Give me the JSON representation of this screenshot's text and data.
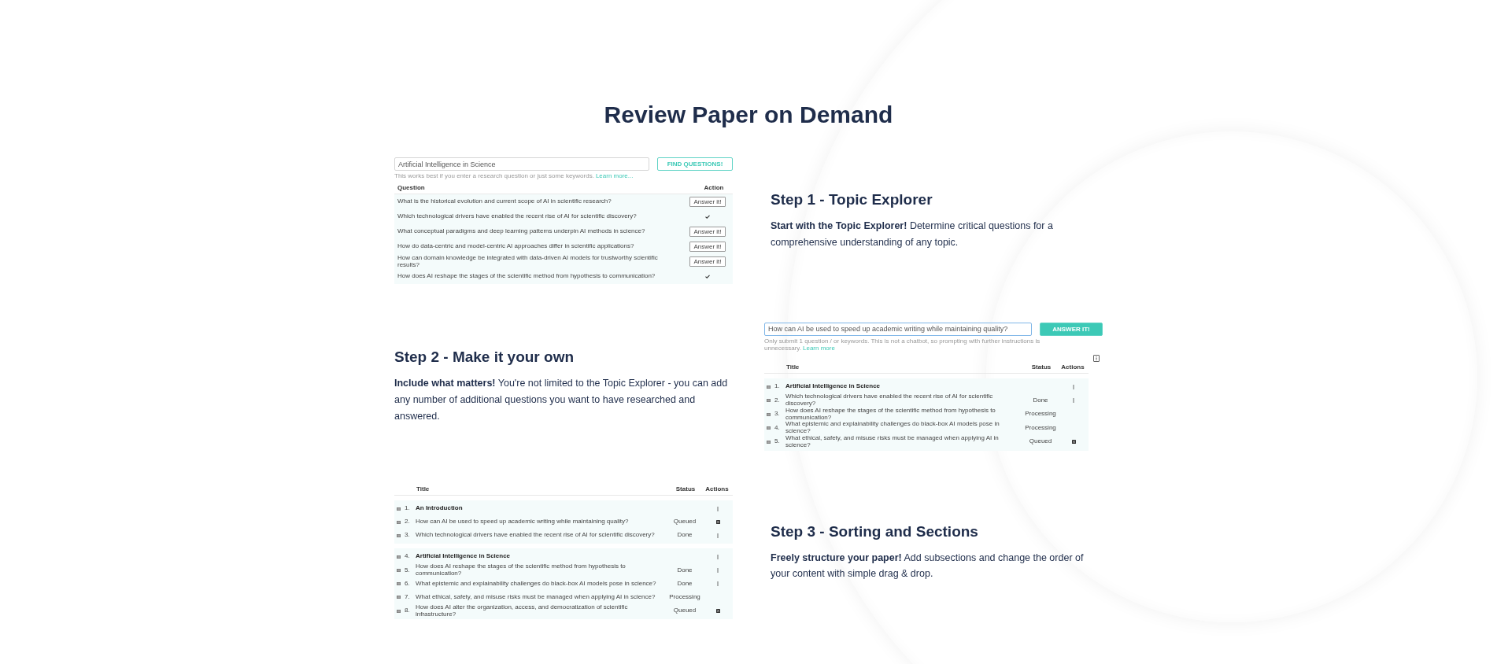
{
  "title": "Review Paper on Demand",
  "steps": [
    {
      "heading": "Step 1 - Topic Explorer",
      "text": "**Start with the Topic Explorer!** Determine critical questions for a comprehensive understanding of any topic."
    },
    {
      "heading": "Step 2 - Make it your own",
      "text": "**Include what matters!** You're not limited to the Topic Explorer - you can add any number of additional questions you want to have researched and answered."
    },
    {
      "heading": "Step 3 - Sorting and Sections",
      "text": "**Freely structure your paper!** Add subsections and change the order of your content with simple drag & drop."
    }
  ],
  "explorer": {
    "query": "Artificial Intelligence in Science",
    "button": "FIND QUESTIONS!",
    "hint": "This works best if you enter a research question or just some keywords.",
    "hint_link": "Learn more...",
    "columns": [
      "Question",
      "Action"
    ],
    "rows": [
      {
        "question": "What is the historical evolution and current scope of AI in scientific research?",
        "action": {
          "kind": "button",
          "label": "Answer it!"
        }
      },
      {
        "question": "Which technological drivers have enabled the recent rise of AI for scientific discovery?",
        "action": {
          "kind": "done"
        }
      },
      {
        "question": "What conceptual paradigms and deep learning patterns underpin AI methods in science?",
        "action": {
          "kind": "button",
          "label": "Answer it!"
        }
      },
      {
        "question": "How do data-centric and model-centric AI approaches differ in scientific applications?",
        "action": {
          "kind": "button",
          "label": "Answer it!"
        }
      },
      {
        "question": "How can domain knowledge be integrated with data-driven AI models for trustworthy scientific results?",
        "action": {
          "kind": "button",
          "label": "Answer it!"
        }
      },
      {
        "question": "How does AI reshape the stages of the scientific method from hypothesis to communication?",
        "action": {
          "kind": "done"
        }
      }
    ]
  },
  "composer": {
    "query": "How can AI be used to speed up academic writing while maintaining quality?",
    "button": "ANSWER IT!",
    "hint": "Only submit 1 question / or keywords. This is not a chatbot, so prompting with further instructions is unnecessary.",
    "hint_link": "Learn more",
    "columns": [
      "Title",
      "Status",
      "Actions"
    ],
    "groups": [
      {
        "rows": [
          {
            "number": "1.",
            "title": "Artificial Intelligence in Science",
            "section": true,
            "action": {
              "kind": "menu"
            }
          },
          {
            "number": "2.",
            "title": "Which technological drivers have enabled the recent rise of AI for scientific discovery?",
            "section": false,
            "status": "Done",
            "action": {
              "kind": "menu"
            }
          },
          {
            "number": "3.",
            "title": "How does AI reshape the stages of the scientific method from hypothesis to communication?",
            "section": false,
            "status": "Processing"
          },
          {
            "number": "4.",
            "title": "What epistemic and explainability challenges do black-box AI models pose in science?",
            "section": false,
            "status": "Processing"
          },
          {
            "number": "5.",
            "title": "What ethical, safety, and misuse risks must be managed when applying AI in science?",
            "section": false,
            "status": "Queued",
            "action": {
              "kind": "cancel"
            }
          }
        ]
      }
    ]
  },
  "outline": {
    "columns": [
      "Title",
      "Status",
      "Actions"
    ],
    "groups": [
      {
        "rows": [
          {
            "number": "1.",
            "title": "An Introduction",
            "section": true,
            "action": {
              "kind": "menu"
            }
          },
          {
            "number": "2.",
            "title": "How can AI be used to speed up academic writing while maintaining quality?",
            "section": false,
            "status": "Queued",
            "action": {
              "kind": "cancel"
            }
          },
          {
            "number": "3.",
            "title": "Which technological drivers have enabled the recent rise of AI for scientific discovery?",
            "section": false,
            "status": "Done",
            "action": {
              "kind": "menu"
            }
          }
        ]
      },
      {
        "rows": [
          {
            "number": "4.",
            "title": "Artificial Intelligence in Science",
            "section": true,
            "action": {
              "kind": "menu"
            }
          },
          {
            "number": "5.",
            "title": "How does AI reshape the stages of the scientific method from hypothesis to communication?",
            "section": false,
            "status": "Done",
            "action": {
              "kind": "menu"
            }
          },
          {
            "number": "6.",
            "title": "What epistemic and explainability challenges do black-box AI models pose in science?",
            "section": false,
            "status": "Done",
            "action": {
              "kind": "menu"
            }
          },
          {
            "number": "7.",
            "title": "What ethical, safety, and misuse risks must be managed when applying AI in science?",
            "section": false,
            "status": "Processing"
          },
          {
            "number": "8.",
            "title": "How does AI alter the organization, access, and democratization of scientific infrastructure?",
            "section": false,
            "status": "Queued",
            "action": {
              "kind": "cancel"
            }
          }
        ]
      }
    ]
  }
}
